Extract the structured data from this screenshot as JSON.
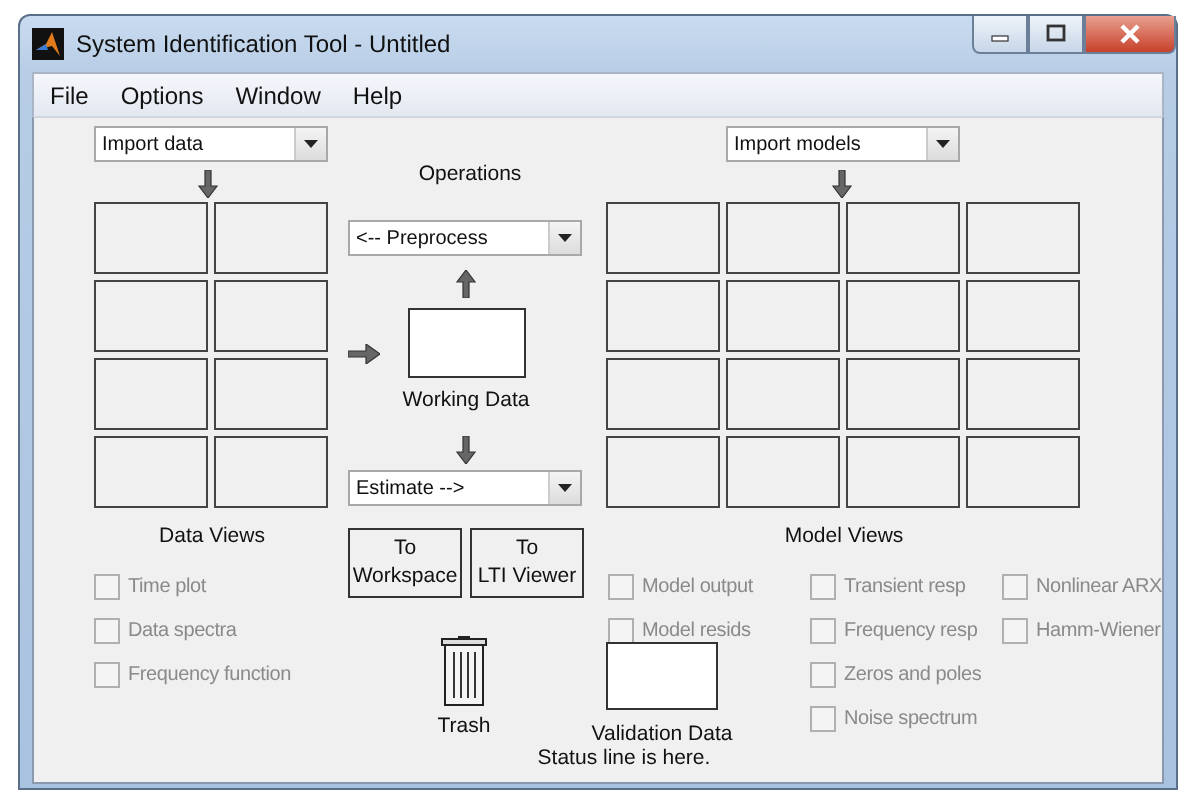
{
  "window": {
    "title": "System Identification Tool - Untitled"
  },
  "menu": [
    "File",
    "Options",
    "Window",
    "Help"
  ],
  "data_import": {
    "value": "Import data"
  },
  "model_import": {
    "value": "Import models"
  },
  "operations": {
    "label": "Operations",
    "preprocess": "<-- Preprocess",
    "working_data": "Working Data",
    "estimate": "Estimate -->"
  },
  "buttons": [
    "To\nWorkspace",
    "To\nLTI Viewer"
  ],
  "data_views": {
    "label": "Data Views",
    "options": [
      {
        "label": "Time plot",
        "checked": false,
        "disabled": true
      },
      {
        "label": "Data spectra",
        "checked": false,
        "disabled": true
      },
      {
        "label": "Frequency function",
        "checked": false,
        "disabled": true
      }
    ]
  },
  "model_views": {
    "label": "Model Views",
    "columns": [
      [
        {
          "label": "Model output",
          "checked": false,
          "disabled": true
        },
        {
          "label": "Model resids",
          "checked": false,
          "disabled": true
        }
      ],
      [
        {
          "label": "Transient resp",
          "checked": false,
          "disabled": true
        },
        {
          "label": "Frequency resp",
          "checked": false,
          "disabled": true
        },
        {
          "label": "Zeros and poles",
          "checked": false,
          "disabled": true
        },
        {
          "label": "Noise spectrum",
          "checked": false,
          "disabled": true
        }
      ],
      [
        {
          "label": "Nonlinear ARX",
          "checked": false,
          "disabled": true
        },
        {
          "label": "Hamm-Wiener",
          "checked": false,
          "disabled": true
        }
      ]
    ]
  },
  "trash": {
    "label": "Trash"
  },
  "validation": {
    "label": "Validation Data"
  },
  "status_line": "Status line is here."
}
